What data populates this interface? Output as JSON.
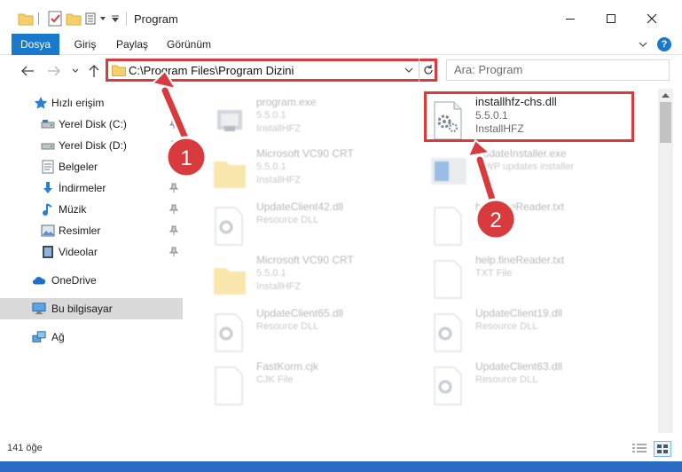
{
  "window": {
    "title": "Program",
    "minimize_glyph": "—",
    "maximize_glyph": "☐",
    "close_glyph": "✕"
  },
  "ribbon": {
    "tabs": [
      "Dosya",
      "Giriş",
      "Paylaş",
      "Görünüm"
    ],
    "help": "?"
  },
  "navigation": {
    "address": "C:\\Program Files\\Program Dizini",
    "search_placeholder": "Ara: Program"
  },
  "sidebar": {
    "items": [
      {
        "label": "Hızlı erişim",
        "icon": "star-icon",
        "pinned": false
      },
      {
        "label": "Yerel Disk (C:)",
        "icon": "drive-icon",
        "pinned": true
      },
      {
        "label": "Yerel Disk (D:)",
        "icon": "drive-icon",
        "pinned": true
      },
      {
        "label": "Belgeler",
        "icon": "documents-icon",
        "pinned": true
      },
      {
        "label": "İndirmeler",
        "icon": "download-icon",
        "pinned": true
      },
      {
        "label": "Müzik",
        "icon": "music-icon",
        "pinned": true
      },
      {
        "label": "Resimler",
        "icon": "pictures-icon",
        "pinned": true
      },
      {
        "label": "Videolar",
        "icon": "videos-icon",
        "pinned": true
      },
      {
        "label": "OneDrive",
        "icon": "cloud-icon",
        "pinned": false
      },
      {
        "label": "Bu bilgisayar",
        "icon": "computer-icon",
        "pinned": false
      },
      {
        "label": "Ağ",
        "icon": "network-icon",
        "pinned": false
      }
    ]
  },
  "files": [
    {
      "name": "program.exe",
      "line1": "5.5.0.1",
      "line2": "InstallHFZ",
      "icon": "exe-icon"
    },
    {
      "name": "installhfz-chs.dll",
      "line1": "5.5.0.1",
      "line2": "InstallHFZ",
      "icon": "dll-gear-icon"
    },
    {
      "name": "Microsoft VC90 CRT",
      "line1": "5.5.0.1",
      "line2": "InstallHFZ",
      "icon": "folder-icon"
    },
    {
      "name": "UpdateInstaller.exe",
      "line1": "WWP updates installer",
      "line2": "",
      "icon": "installer-icon"
    },
    {
      "name": "UpdateClient42.dll",
      "line1": "Resource DLL",
      "line2": "",
      "icon": "dll-gear-icon"
    },
    {
      "name": "help.fineReader.txt",
      "line1": "TXT File",
      "line2": "",
      "icon": "text-file-icon"
    },
    {
      "name": "Microsoft VC90 CRT",
      "line1": "5.5.0.1",
      "line2": "InstallHFZ",
      "icon": "folder-icon"
    },
    {
      "name": "help.fineReader.txt",
      "line1": "TXT File",
      "line2": "",
      "icon": "text-file-icon"
    },
    {
      "name": "UpdateClient65.dll",
      "line1": "Resource DLL",
      "line2": "",
      "icon": "dll-gear-icon"
    },
    {
      "name": "UpdateClient19.dll",
      "line1": "Resource DLL",
      "line2": "",
      "icon": "dll-gear-icon"
    },
    {
      "name": "FastKorm.cjk",
      "line1": "CJK File",
      "line2": "",
      "icon": "generic-file-icon"
    },
    {
      "name": "UpdateClient63.dll",
      "line1": "Resource DLL",
      "line2": "",
      "icon": "dll-gear-icon"
    }
  ],
  "status": {
    "count": "141 öğe"
  },
  "annotations": {
    "badges": [
      "1",
      "2"
    ],
    "highlight_color": "#d93a3e"
  },
  "colors": {
    "accent": "#1979ca",
    "selection": "#cce8ff",
    "annotation": "#d93a3e"
  }
}
